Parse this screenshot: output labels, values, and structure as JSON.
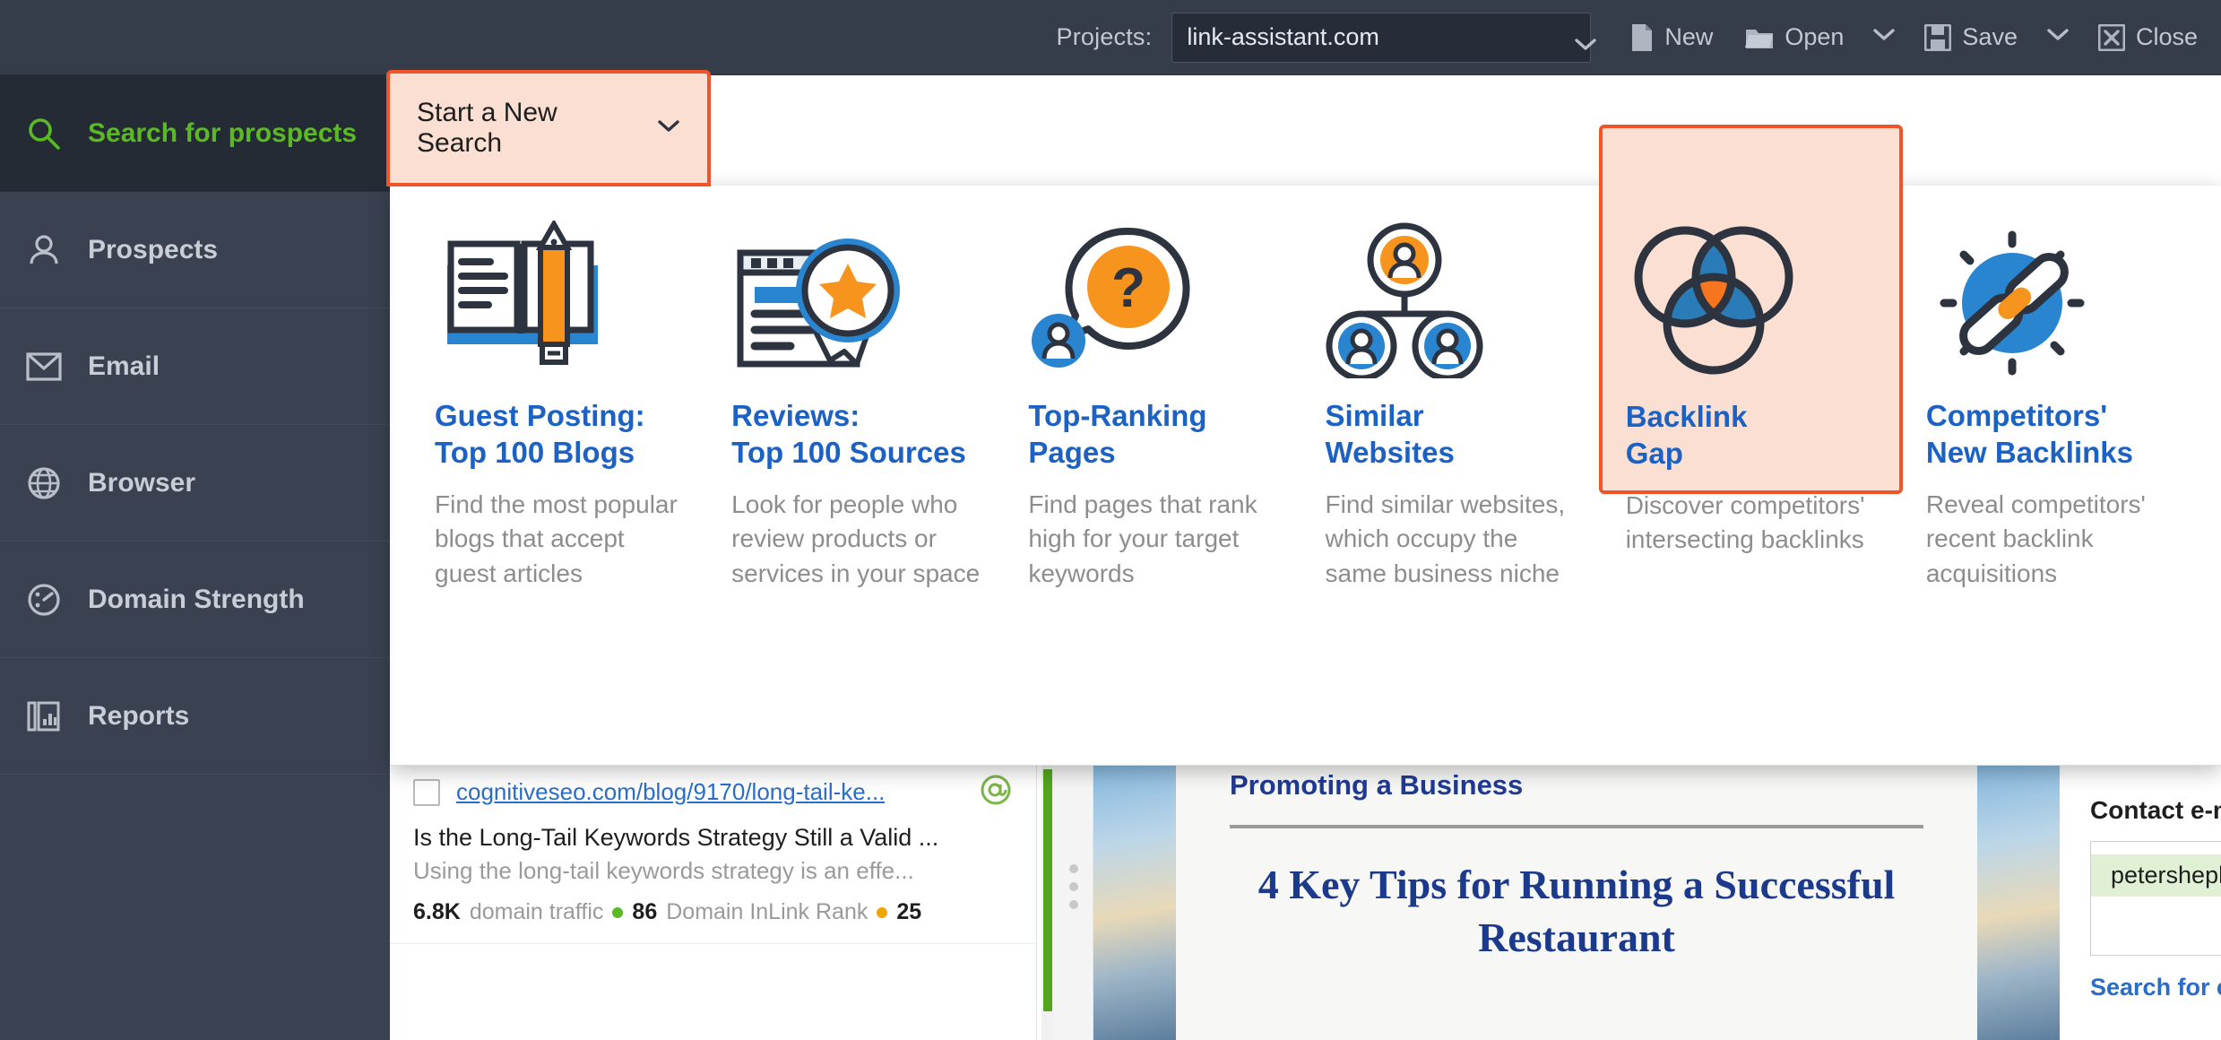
{
  "toolbar": {
    "projects_label": "Projects:",
    "project_value": "link-assistant.com",
    "new_label": "New",
    "open_label": "Open",
    "save_label": "Save",
    "close_label": "Close",
    "icons": {
      "new": "new-document-icon",
      "open": "open-folder-icon",
      "save": "floppy-disk-icon",
      "close": "close-x-icon",
      "project_caret": "chevron-down-icon"
    }
  },
  "sidebar": {
    "items": [
      {
        "label": "Search for prospects",
        "icon": "magnifier-icon",
        "active": true
      },
      {
        "label": "Prospects",
        "icon": "person-icon",
        "active": false
      },
      {
        "label": "Email",
        "icon": "envelope-icon",
        "active": false
      },
      {
        "label": "Browser",
        "icon": "globe-icon",
        "active": false
      },
      {
        "label": "Domain Strength",
        "icon": "gauge-icon",
        "active": false
      },
      {
        "label": "Reports",
        "icon": "report-chart-icon",
        "active": false
      }
    ]
  },
  "new_search": {
    "label": "Start a New Search",
    "caret_icon": "chevron-down-icon"
  },
  "dropdown": {
    "cards": [
      {
        "title": "Guest Posting:\nTop 100 Blogs",
        "desc": "Find the most popular blogs that accept guest articles",
        "icon": "open-book-pencil-icon",
        "highlight": false
      },
      {
        "title": "Reviews:\nTop 100 Sources",
        "desc": "Look for people who review products or services in your space",
        "icon": "certificate-badge-icon",
        "highlight": false
      },
      {
        "title": "Top-Ranking\nPages",
        "desc": "Find pages that rank high for your target keywords",
        "icon": "question-bubble-icon",
        "highlight": false
      },
      {
        "title": "Similar\nWebsites",
        "desc": "Find similar websites, which occupy the same business niche",
        "icon": "network-people-icon",
        "highlight": false
      },
      {
        "title": "Backlink\nGap",
        "desc": "Discover competitors' intersecting backlinks",
        "icon": "venn-diagram-icon",
        "highlight": true
      },
      {
        "title": "Competitors'\nNew Backlinks",
        "desc": "Reveal competitors' recent backlink acquisitions",
        "icon": "chain-link-icon",
        "highlight": false
      }
    ]
  },
  "prospect_row": {
    "url": "cognitiveseo.com/blog/9170/long-tail-ke...",
    "at_icon": "at-sign-icon",
    "title": "Is the Long-Tail Keywords Strategy Still a Valid ...",
    "desc": "Using the long-tail keywords strategy is an effe...",
    "metric1_value": "6.8K",
    "metric1_label": "domain traffic",
    "metric2_value": "86",
    "metric2_label": "Domain InLink Rank",
    "metric3_value": "25",
    "metric3_label": ""
  },
  "preview": {
    "kicker": "Promoting a Business",
    "headline": "4 Key Tips for Running a Successful Restaurant"
  },
  "right_panel": {
    "title": "Contact e-mail(s):",
    "email": "petershepherd@me.co",
    "link": "Search for e-mails"
  },
  "colors": {
    "toolbar_bg": "#363d4a",
    "sidebar_bg": "#3a4150",
    "sidebar_active_bg": "#252b35",
    "accent_green": "#5bb925",
    "highlight_border": "#f0542a",
    "highlight_fill": "#fbdfd2",
    "card_title_blue": "#1b62c4",
    "icon_blue": "#2a85d0",
    "icon_orange": "#f7941e",
    "icon_dark": "#2d3440"
  }
}
